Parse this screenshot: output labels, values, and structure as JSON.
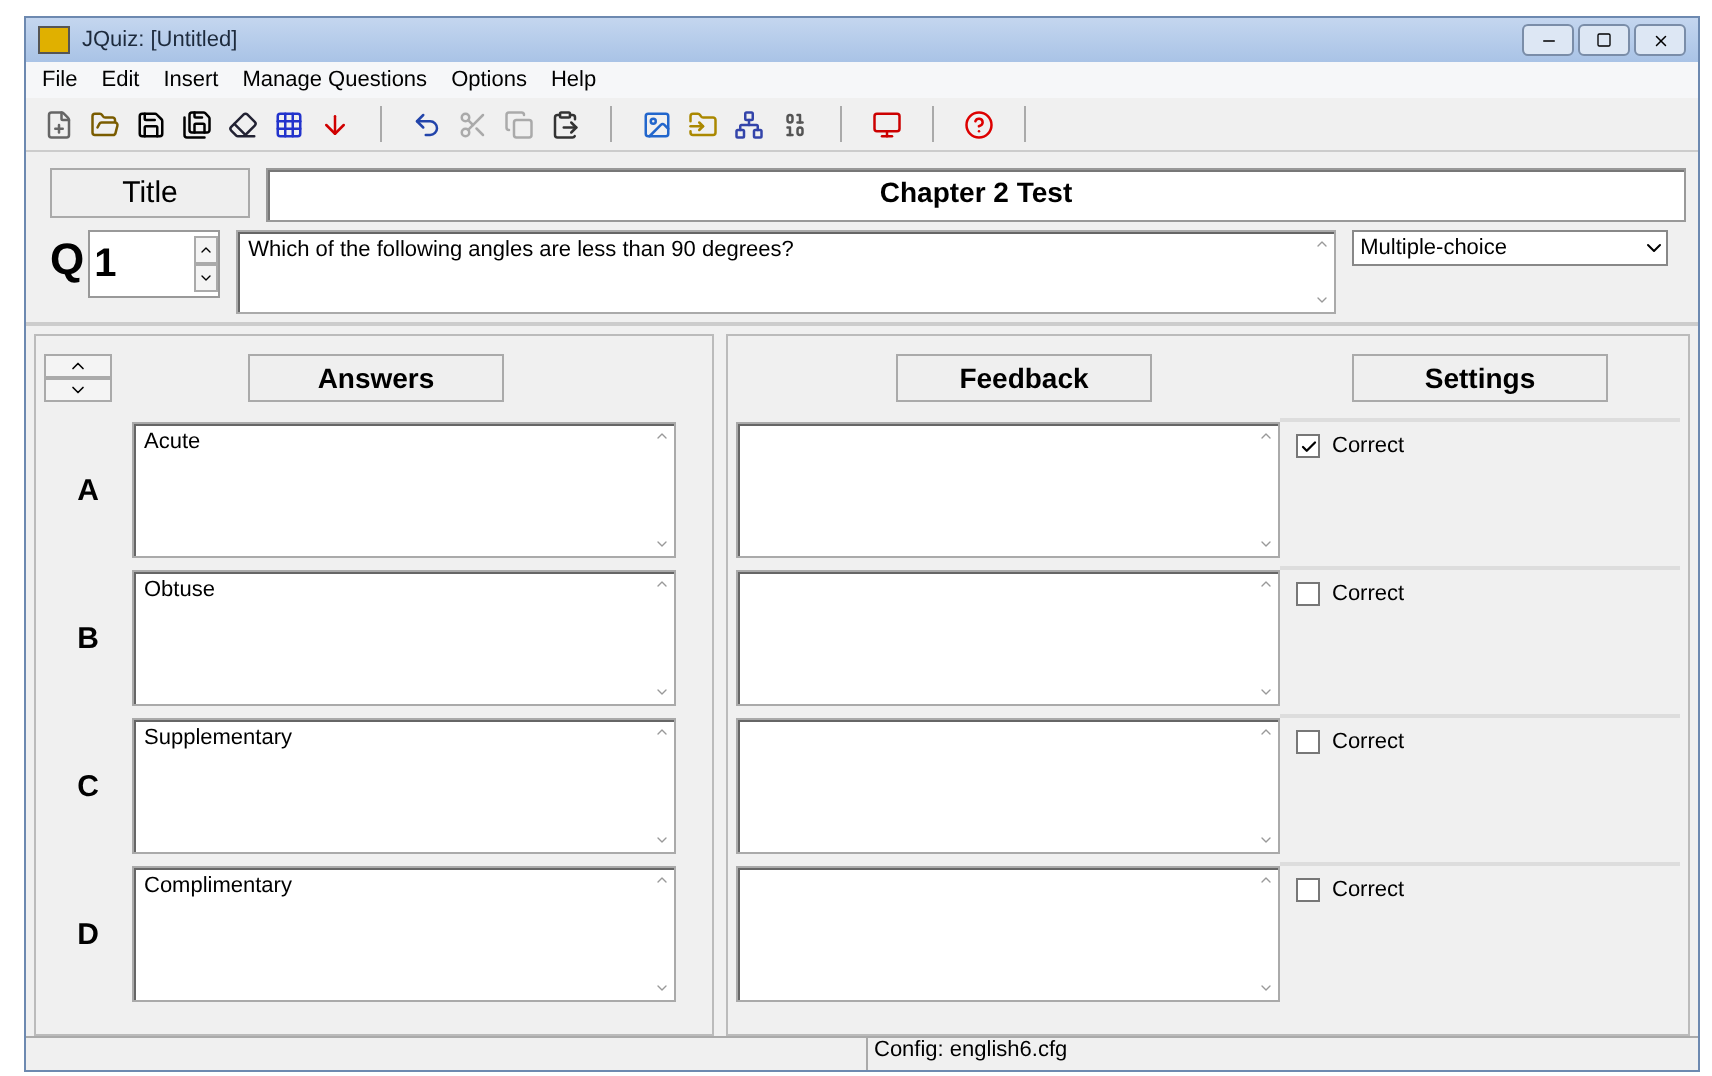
{
  "window": {
    "title": "JQuiz: [Untitled]"
  },
  "menu": [
    "File",
    "Edit",
    "Insert",
    "Manage Questions",
    "Options",
    "Help"
  ],
  "title_button": "Title",
  "title_value": "Chapter 2 Test",
  "question": {
    "label": "Q",
    "number": "1",
    "text": "Which of the following angles are less than 90 degrees?",
    "type": "Multiple-choice"
  },
  "headers": {
    "answers": "Answers",
    "feedback": "Feedback",
    "settings": "Settings"
  },
  "answers": [
    {
      "letter": "A",
      "text": "Acute",
      "correct_label": "Correct",
      "checked": true
    },
    {
      "letter": "B",
      "text": "Obtuse",
      "correct_label": "Correct",
      "checked": false
    },
    {
      "letter": "C",
      "text": "Supplementary",
      "correct_label": "Correct",
      "checked": false
    },
    {
      "letter": "D",
      "text": "Complimentary",
      "correct_label": "Correct",
      "checked": false
    }
  ],
  "status_bar": "Config: english6.cfg"
}
